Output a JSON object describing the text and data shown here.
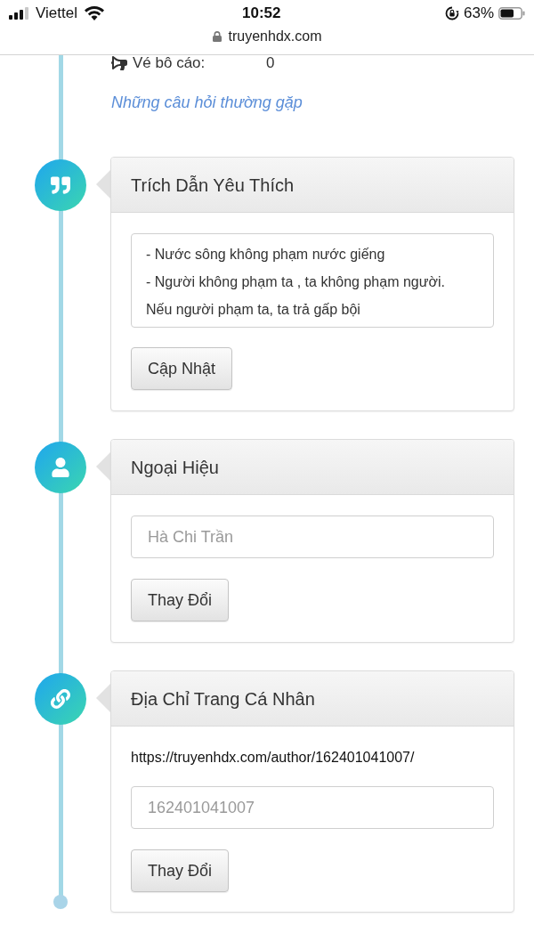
{
  "status_bar": {
    "carrier": "Viettel",
    "time": "10:52",
    "battery": "63%"
  },
  "address_bar": {
    "domain": "truyenhdx.com"
  },
  "stats": [
    {
      "label": "Vé bô cáo:",
      "value": "0"
    }
  ],
  "faq_link": "Những câu hỏi thường gặp",
  "sections": [
    {
      "kind": "quote",
      "title": "Trích Dẫn Yêu Thích",
      "textarea": {
        "value": "- Nước sông không phạm nước giếng\n- Người không phạm ta , ta không phạm người.\nNếu người phạm ta, ta trả gấp bội"
      },
      "button": "Cập Nhật"
    },
    {
      "kind": "nickname",
      "title": "Ngoại Hiệu",
      "input": {
        "placeholder": "Hà Chi Trần"
      },
      "button": "Thay Đổi"
    },
    {
      "kind": "profile_url",
      "title": "Địa Chỉ Trang Cá Nhân",
      "url": "https://truyenhdx.com/author/162401041007/",
      "input": {
        "placeholder": "162401041007"
      },
      "button": "Thay Đổi"
    }
  ]
}
